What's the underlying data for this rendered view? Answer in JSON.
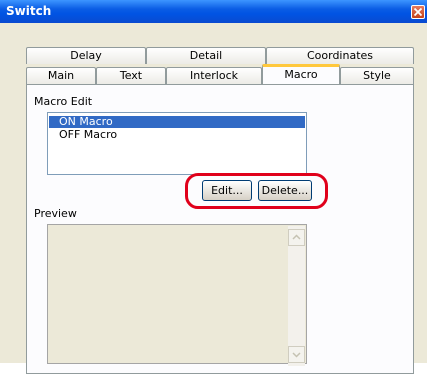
{
  "window": {
    "title": "Switch"
  },
  "tabs": {
    "row_top": [
      "Delay",
      "Detail",
      "Coordinates"
    ],
    "row_bottom": [
      "Main",
      "Text",
      "Interlock",
      "Macro",
      "Style"
    ],
    "active": "Macro"
  },
  "macro_edit": {
    "label": "Macro Edit",
    "items": [
      "ON Macro",
      "OFF Macro"
    ],
    "selected": "ON Macro"
  },
  "buttons": {
    "edit": "Edit...",
    "delete": "Delete..."
  },
  "preview": {
    "label": "Preview"
  },
  "colors": {
    "titlebar": "#0054e3",
    "selection": "#316ac5",
    "highlight_ring": "#e0001b",
    "active_tab_accent": "#ffc83c"
  },
  "icons": {
    "close": "close-icon",
    "scroll_up": "scroll-up-arrow-icon",
    "scroll_down": "scroll-down-arrow-icon"
  }
}
